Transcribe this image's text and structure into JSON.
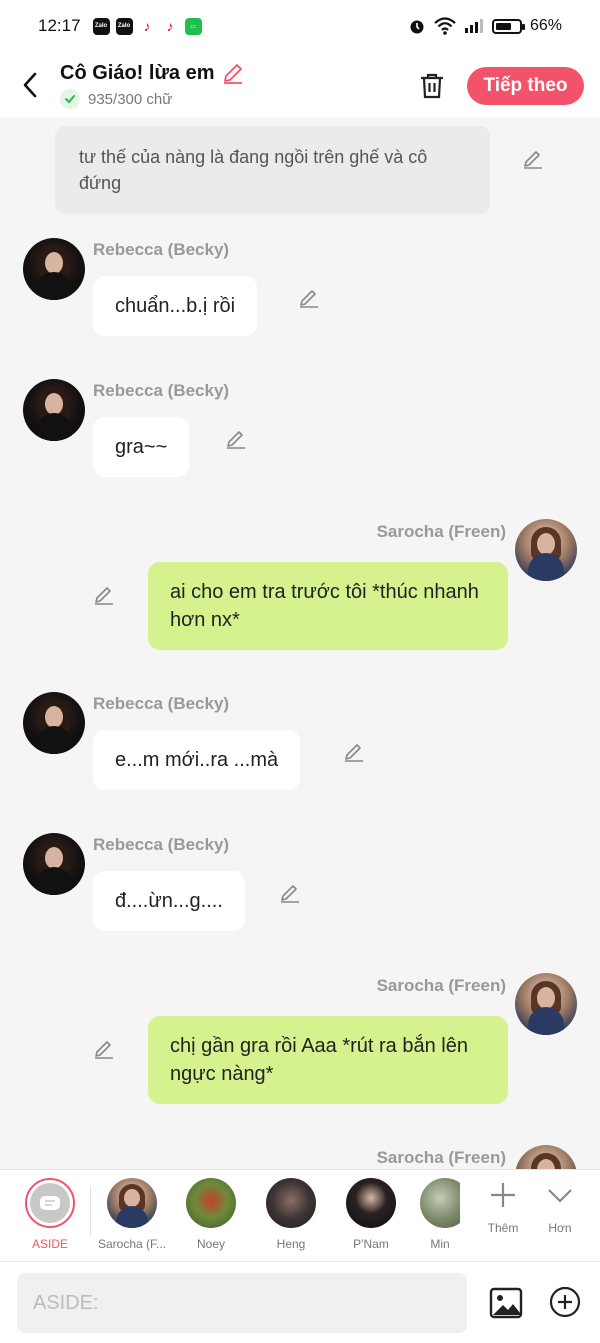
{
  "status_bar": {
    "time": "12:17",
    "notifications": [
      "Zalo",
      "Zalo",
      "tiktok",
      "tiktok",
      "messages"
    ],
    "battery_text": "66%",
    "battery_level": 0.66
  },
  "header": {
    "title": "Cô Giáo! lừa em",
    "word_count": "935/300 chữ",
    "next_label": "Tiếp theo",
    "accent_color": "#f2536b"
  },
  "chat": {
    "aside_text": "tư thế của nàng là đang ngồi trên ghế và cô đứng",
    "messages": [
      {
        "sender": "Rebecca (Becky)",
        "side": "left",
        "text": "chuẩn...b.ị rồi"
      },
      {
        "sender": "Rebecca (Becky)",
        "side": "left",
        "text": "gra~~"
      },
      {
        "sender": "Sarocha (Freen)",
        "side": "right",
        "text": "ai cho em tra trước tôi *thúc nhanh hơn nx*"
      },
      {
        "sender": "Rebecca (Becky)",
        "side": "left",
        "text": "e...m mới..ra ...mà"
      },
      {
        "sender": "Rebecca (Becky)",
        "side": "left",
        "text": "đ....ừn...g...."
      },
      {
        "sender": "Sarocha (Freen)",
        "side": "right",
        "text": "chị gần gra rồi Aaa *rút ra bắn lên ngực nàng*"
      },
      {
        "sender": "Sarocha (Freen)",
        "side": "right",
        "text": ""
      }
    ]
  },
  "characters": {
    "aside_label": "ASIDE",
    "list": [
      "Sarocha (F...",
      "Noey",
      "Heng",
      "P'Nam",
      "Min"
    ],
    "more_label": "Thêm",
    "expand_label": "Hơn"
  },
  "input": {
    "placeholder": "ASIDE:"
  }
}
